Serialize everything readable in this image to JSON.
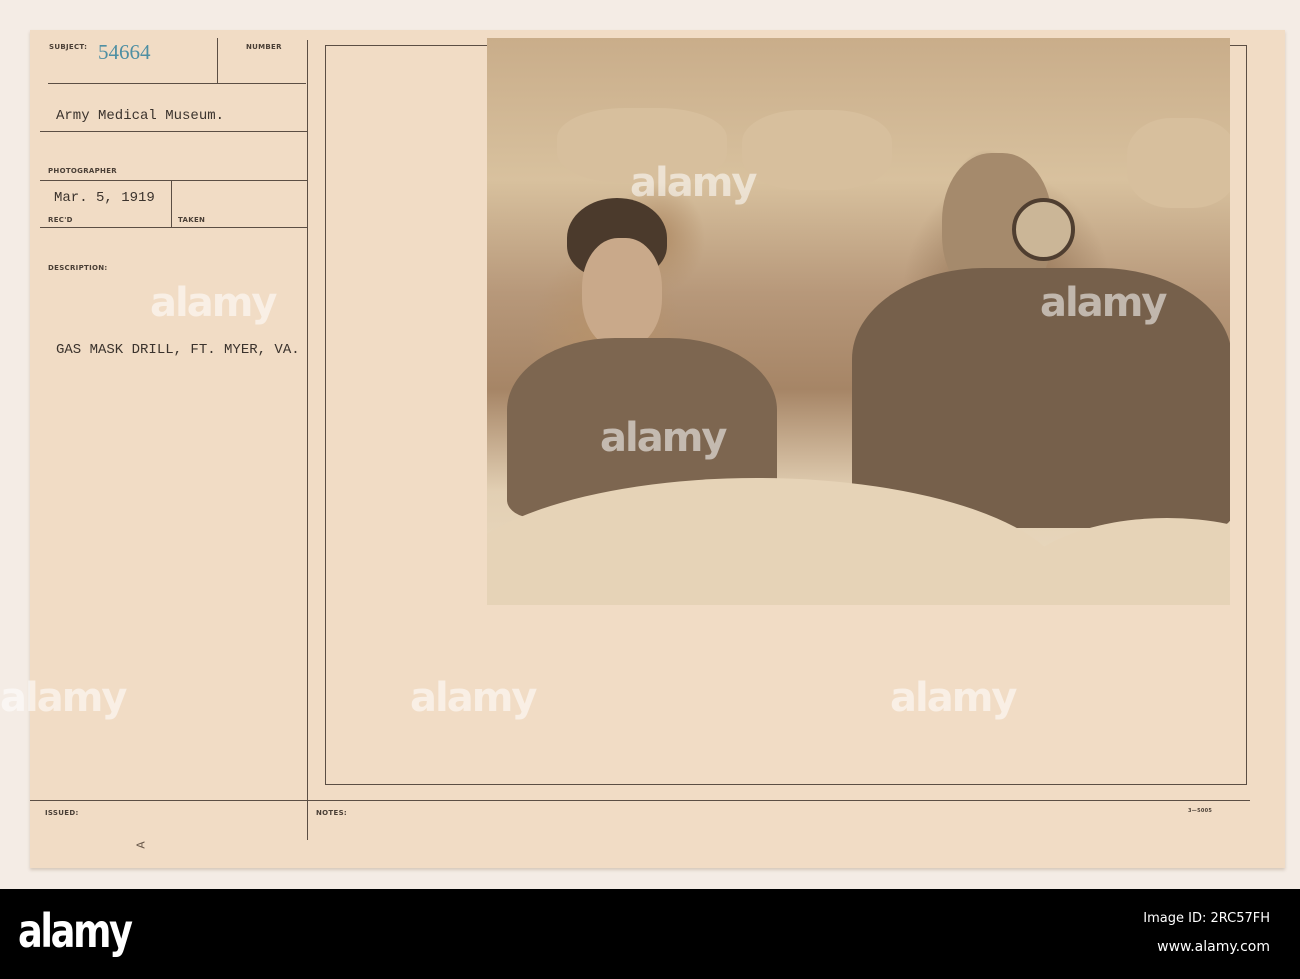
{
  "card": {
    "subject_label": "SUBJECT:",
    "subject_number": "54664",
    "number_label": "NUMBER",
    "institution": "Army Medical Museum.",
    "photographer_label": "PHOTOGRAPHER",
    "date": "Mar. 5, 1919",
    "recd_label": "REC'D",
    "taken_label": "TAKEN",
    "description_label": "DESCRIPTION:",
    "description": "GAS MASK DRILL, FT. MYER, VA.",
    "issued_label": "ISSUED:",
    "notes_label": "NOTES:",
    "form_number": "3—5005",
    "margin_mark": "A"
  },
  "watermark": "alamy",
  "footer": {
    "logo": "alamy",
    "image_id": "Image ID: 2RC57FH",
    "url": "www.alamy.com"
  },
  "colors": {
    "card": "#f1dcc5",
    "subject_number": "#4f8fa3",
    "footer": "#000000"
  }
}
